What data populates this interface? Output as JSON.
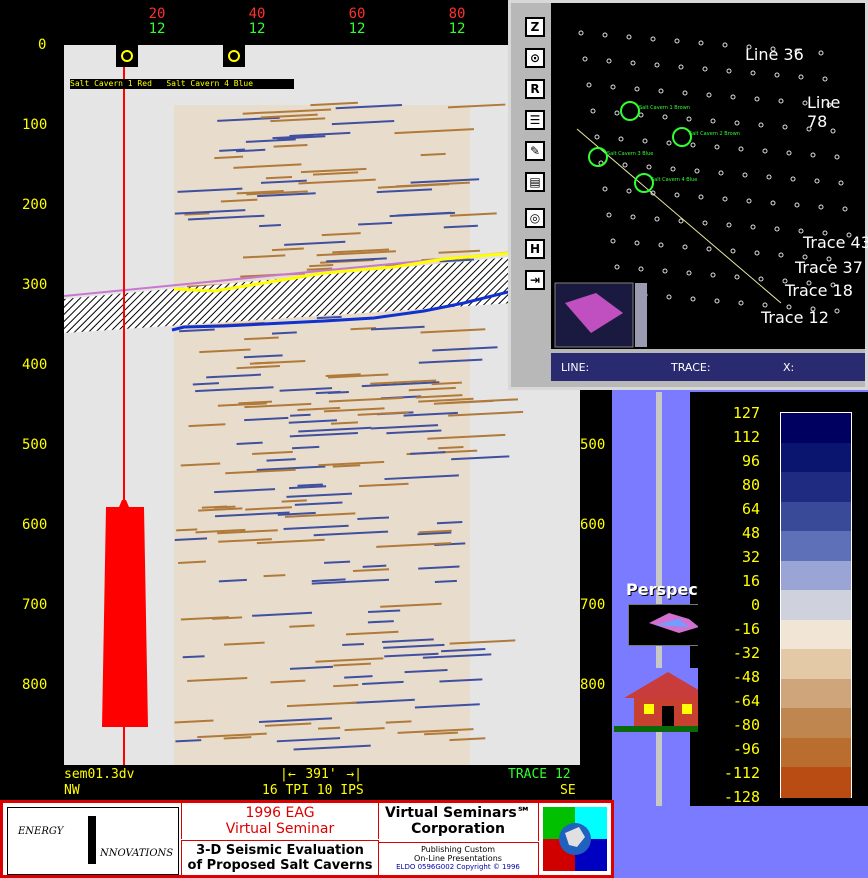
{
  "top_axis": {
    "numbers": [
      {
        "top": "20",
        "bottom": "12"
      },
      {
        "top": "40",
        "bottom": "12"
      },
      {
        "top": "60",
        "bottom": "12"
      },
      {
        "top": "80",
        "bottom": "12"
      }
    ]
  },
  "left_axis": [
    "0",
    "100",
    "200",
    "300",
    "400",
    "500",
    "600",
    "700",
    "800"
  ],
  "right_axis": [
    "500",
    "600",
    "700",
    "800"
  ],
  "well_labels": {
    "label1": "Salt Cavern 1 Red",
    "label2": "Salt Cavern 4 Blue"
  },
  "bottom_bar": {
    "file": "sem01.3dv",
    "scale": "391'",
    "tpi": "16 TPI 10 IPS",
    "trace": "TRACE 12",
    "nw": "NW",
    "se": "SE"
  },
  "map": {
    "labels": [
      "Line 36",
      "Line 78",
      "Trace 43",
      "Trace 37",
      "Trace 18",
      "Trace 12"
    ],
    "status": {
      "line": "LINE:",
      "trace": "TRACE:",
      "x": "X:"
    },
    "tools": [
      "Z",
      "⊙",
      "R",
      "☰",
      "✎",
      "▤",
      "◎",
      "H",
      "⇥"
    ],
    "cavern_labels": [
      "Salt Cavern 1 Brown",
      "Salt Cavern 2 Brown",
      "Salt Cavern 3 Blue",
      "Salt Cavern 4 Blue"
    ]
  },
  "colorbar": {
    "labels": [
      "127",
      "112",
      "96",
      "80",
      "64",
      "48",
      "32",
      "16",
      "0",
      "-16",
      "-32",
      "-48",
      "-64",
      "-80",
      "-96",
      "-112",
      "-128"
    ],
    "colors": [
      "#000060",
      "#0a1570",
      "#1e2b80",
      "#384a98",
      "#5d70b8",
      "#9aa5d5",
      "#cfd1dd",
      "#f1e6d6",
      "#e4c9a7",
      "#cfa57c",
      "#bf8650",
      "#b96d2e",
      "#b84c12"
    ]
  },
  "perspective": {
    "label": "Perspective"
  },
  "footer": {
    "logo_line1": "ENERGY",
    "logo_line2": "NNOVATIONS",
    "eag_line1": "1996 EAG",
    "eag_line2": "Virtual Seminar",
    "title_line1": "3-D Seismic Evaluation",
    "title_line2": "of Proposed Salt Caverns",
    "vs_line1": "Virtual Seminars℠",
    "vs_line2": "Corporation",
    "pub_line1": "Publishing Custom",
    "pub_line2": "On-Line Presentations",
    "copyright": "ELDO 0596G002 Copyright © 1996"
  }
}
